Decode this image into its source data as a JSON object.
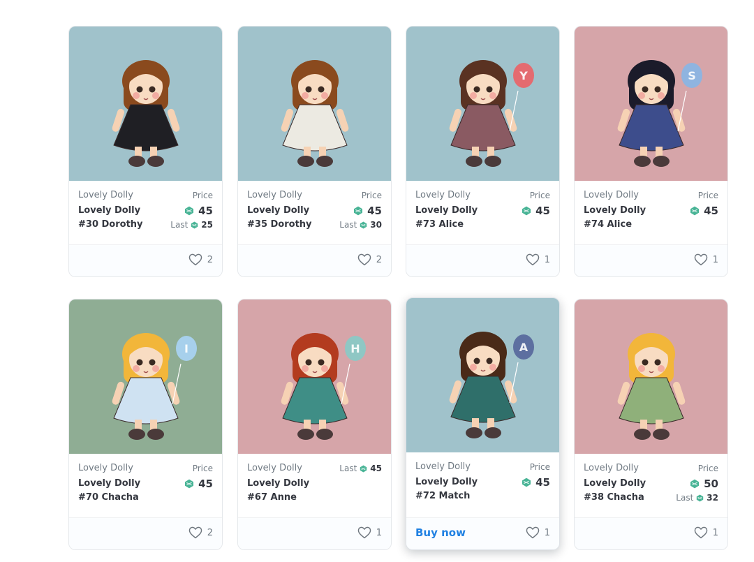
{
  "colors": {
    "bg_blue": "#a0c2cb",
    "bg_pink": "#d6a5a9",
    "bg_green": "#8fad94",
    "accent_link": "#2081e2",
    "gem": "#49b496"
  },
  "cards": [
    {
      "collection": "Lovely Dolly",
      "name": "Lovely Dolly #30 Dorothy",
      "price_label": "Price",
      "price": "45",
      "last_label": "Last",
      "last": "25",
      "likes": "2",
      "bg": "blue",
      "balloon": ""
    },
    {
      "collection": "Lovely Dolly",
      "name": "Lovely Dolly #35 Dorothy",
      "price_label": "Price",
      "price": "45",
      "last_label": "Last",
      "last": "30",
      "likes": "2",
      "bg": "blue",
      "balloon": ""
    },
    {
      "collection": "Lovely Dolly",
      "name": "Lovely Dolly #73 Alice",
      "price_label": "Price",
      "price": "45",
      "likes": "1",
      "bg": "blue",
      "balloon": "Y"
    },
    {
      "collection": "Lovely Dolly",
      "name": "Lovely Dolly #74 Alice",
      "price_label": "Price",
      "price": "45",
      "likes": "1",
      "bg": "pink",
      "balloon": "S"
    },
    {
      "collection": "Lovely Dolly",
      "name": "Lovely Dolly #70 Chacha",
      "price_label": "Price",
      "price": "45",
      "likes": "2",
      "bg": "green",
      "balloon": "I"
    },
    {
      "collection": "Lovely Dolly",
      "name": "Lovely Dolly #67 Anne",
      "last_label": "Last",
      "last": "45",
      "likes": "1",
      "bg": "pink",
      "balloon": "H"
    },
    {
      "collection": "Lovely Dolly",
      "name": "Lovely Dolly #72 Match",
      "price_label": "Price",
      "price": "45",
      "likes": "1",
      "bg": "blue",
      "balloon": "A",
      "buy_label": "Buy now"
    },
    {
      "collection": "Lovely Dolly",
      "name": "Lovely Dolly #38 Chacha",
      "price_label": "Price",
      "price": "50",
      "last_label": "Last",
      "last": "32",
      "likes": "1",
      "bg": "pink",
      "balloon": ""
    }
  ]
}
